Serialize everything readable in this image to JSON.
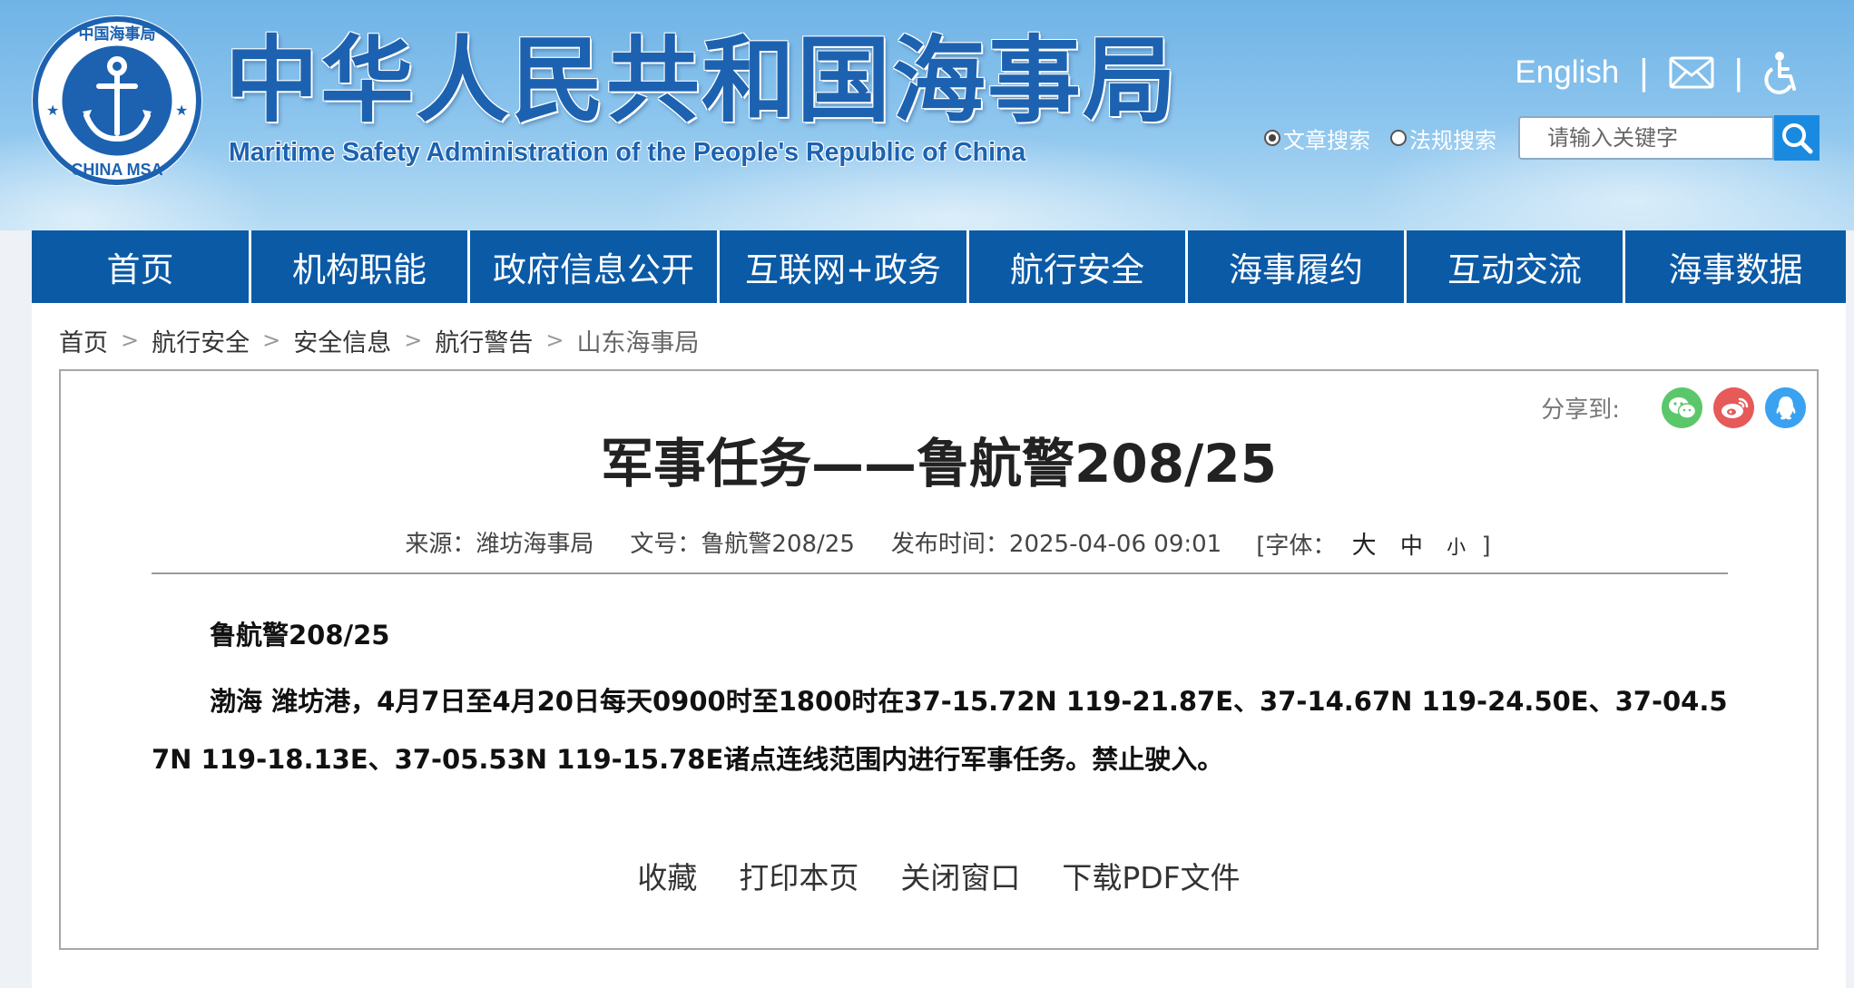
{
  "header": {
    "title_cn": "中华人民共和国海事局",
    "title_en": "Maritime Safety Administration of the People's Republic of China",
    "logo_text": "中国海事局 CHINA MSA",
    "english_link": "English",
    "search": {
      "options": [
        "文章搜索",
        "法规搜索"
      ],
      "selected": "文章搜索",
      "placeholder": "请输入关键字"
    }
  },
  "nav": {
    "items": [
      "首页",
      "机构职能",
      "政府信息公开",
      "互联网+政务",
      "航行安全",
      "海事履约",
      "互动交流",
      "海事数据"
    ]
  },
  "breadcrumb": [
    "首页",
    "航行安全",
    "安全信息",
    "航行警告",
    "山东海事局"
  ],
  "share": {
    "label": "分享到:",
    "icons": [
      "wechat-icon",
      "weibo-icon",
      "qq-icon"
    ]
  },
  "article": {
    "title": "军事任务——鲁航警208/25",
    "meta": {
      "source": "来源：潍坊海事局",
      "doc_no": "文号：鲁航警208/25",
      "published": "发布时间：2025-04-06 09:01",
      "font_label": "[字体：",
      "font_sizes": [
        "大",
        "中",
        "小"
      ],
      "font_close": "]"
    },
    "code": "鲁航警208/25",
    "body": "渤海 潍坊港，4月7日至4月20日每天0900时至1800时在37-15.72N 119-21.87E、37-14.67N 119-24.50E、37-04.57N 119-18.13E、37-05.53N 119-15.78E诸点连线范围内进行军事任务。禁止驶入。"
  },
  "actions": [
    "收藏",
    "打印本页",
    "关闭窗口",
    "下载PDF文件"
  ],
  "colors": {
    "nav_bg": "#0b5aa6",
    "title_blue": "#1d62b0",
    "search_btn": "#1a8ae0",
    "wechat": "#5cc76a",
    "weibo": "#e65a5a",
    "qq": "#3aa2f0"
  }
}
